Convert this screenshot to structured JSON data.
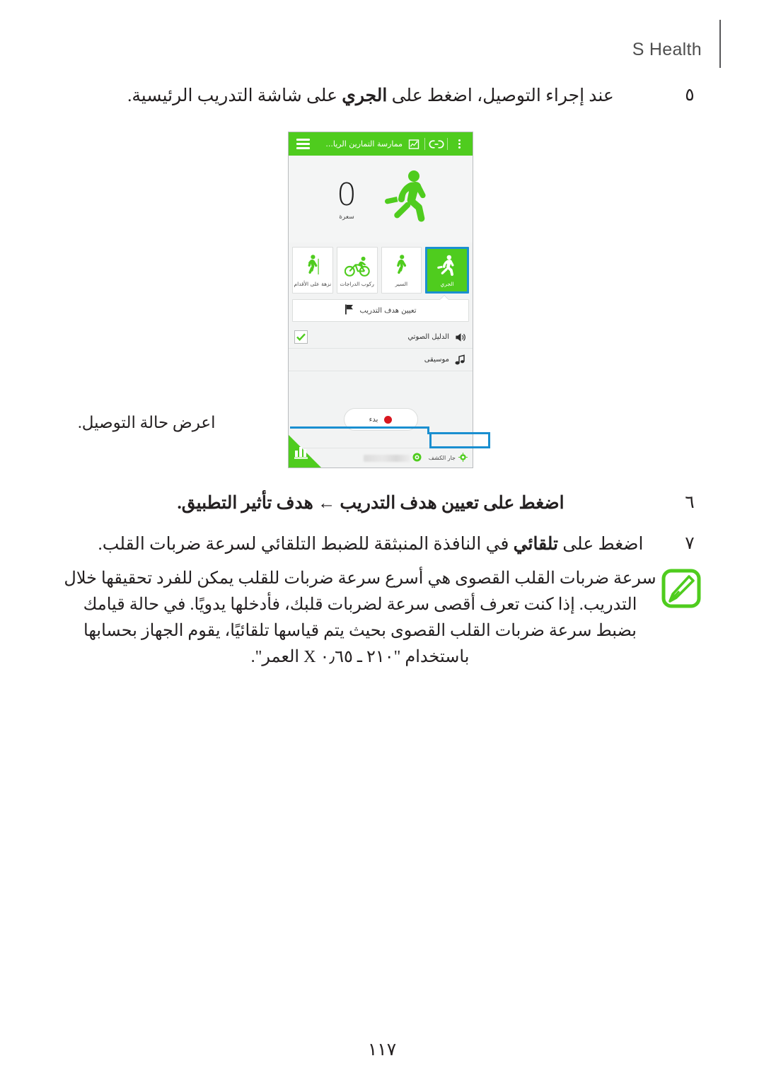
{
  "header": {
    "brand": "S Health"
  },
  "steps": [
    {
      "number": "٥",
      "text_before": "عند إجراء التوصيل، اضغط على ",
      "bold": "الجري",
      "text_after": " على شاشة التدريب الرئيسية."
    },
    {
      "number": "٦",
      "text_before": "اضغط على ",
      "bold": "تعيين هدف التدريب ← هدف تأثير التطبيق",
      "text_after": "."
    },
    {
      "number": "٧",
      "text_before": "اضغط على ",
      "bold": "تلقائي",
      "text_after": " في النافذة المنبثقة للضبط التلقائي لسرعة ضربات القلب."
    }
  ],
  "note": {
    "icon": "note-pencil-icon",
    "text": "سرعة ضربات القلب القصوى هي أسرع سرعة ضربات للقلب يمكن للفرد تحقيقها خلال التدريب. إذا كنت تعرف أقصى سرعة لضربات قلبك، فأدخلها يدويًا. في حالة قيامك بضبط سرعة ضربات القلب القصوى بحيث يتم قياسها تلقائيًا، يقوم الجهاز بحسابها باستخدام \"٢١٠ ـ ٠٫٦٥ X العمر\"."
  },
  "callout": {
    "label": "اعرض حالة التوصيل."
  },
  "page_number": "١١٧",
  "phone": {
    "actionbar": {
      "menu_icon": "hamburger-icon",
      "title": "ممارسة التمارين الريا...",
      "chart_icon": "trend-chart-icon",
      "link_icon": "link-chain-icon",
      "overflow_icon": "overflow-menu-icon"
    },
    "hero": {
      "avatar_icon": "running-person-icon",
      "value": "0",
      "unit": "سعرة"
    },
    "tiles": [
      {
        "label": "الجري",
        "icon": "running-icon",
        "selected": true
      },
      {
        "label": "السير",
        "icon": "walking-icon",
        "selected": false
      },
      {
        "label": "ركوب الدراجات",
        "icon": "cycling-icon",
        "selected": false
      },
      {
        "label": "نزهة على الأقدام",
        "icon": "hiking-icon",
        "selected": false
      }
    ],
    "goal_button": {
      "label": "تعيين هدف التدريب",
      "icon": "flag-icon"
    },
    "rows": [
      {
        "label": "الدليل الصوتي",
        "icon": "speaker-icon",
        "checked": true
      },
      {
        "label": "موسيقى",
        "icon": "music-note-icon",
        "checked": false
      }
    ],
    "start_button": {
      "label": "بدء",
      "icon": "record-dot-icon",
      "dot_color": "#d8171f"
    },
    "statusbar": {
      "gps_label": "جار الكشف",
      "gps_icon": "gps-icon",
      "device_icon": "device-connected-icon",
      "device_name_redacted": true
    },
    "corner_button": {
      "icon": "bar-chart-icon"
    },
    "accent_color": "#4fcc1e",
    "highlight_color": "#1a8fd0"
  }
}
